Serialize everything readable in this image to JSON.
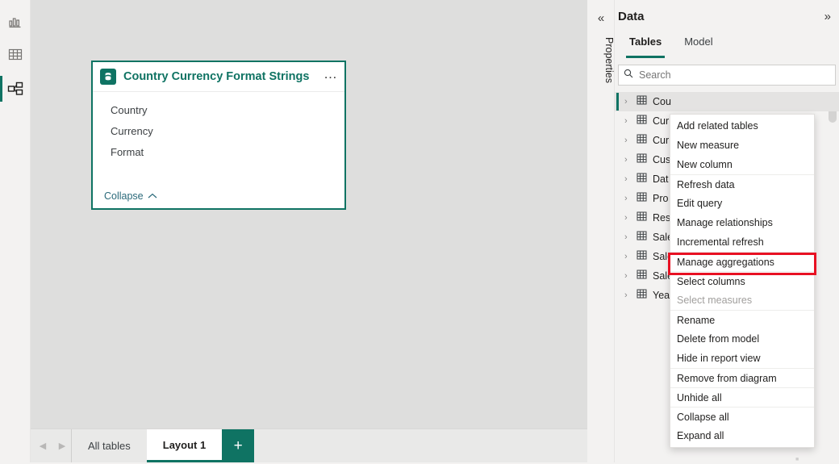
{
  "rail": {
    "items": [
      {
        "name": "report-view",
        "icon": "bar-chart-icon",
        "active": false
      },
      {
        "name": "table-view",
        "icon": "table-grid-icon",
        "active": false
      },
      {
        "name": "model-view",
        "icon": "model-diagram-icon",
        "active": true
      }
    ]
  },
  "canvas": {
    "table_card": {
      "icon": "database-table-icon",
      "title": "Country Currency Format Strings",
      "more_label": "…",
      "fields": [
        "Country",
        "Currency",
        "Format"
      ],
      "collapse_label": "Collapse",
      "border_color": "#0f7363"
    }
  },
  "tabstrip": {
    "prev_arrow": "◀",
    "next_arrow": "▶",
    "tabs": [
      {
        "label": "All tables",
        "active": false
      },
      {
        "label": "Layout 1",
        "active": true
      }
    ],
    "add_label": "+",
    "add_color": "#0f7363"
  },
  "properties_strip": {
    "collapse_icon": "«",
    "label": "Properties"
  },
  "data_pane": {
    "title": "Data",
    "expand_icon": "»",
    "tabs": [
      {
        "label": "Tables",
        "active": true
      },
      {
        "label": "Model",
        "active": false
      }
    ],
    "search": {
      "placeholder": "Search",
      "value": "",
      "icon": "search-icon"
    },
    "tables": [
      {
        "label": "Cou",
        "selected": true
      },
      {
        "label": "Cur",
        "selected": false
      },
      {
        "label": "Cur",
        "selected": false
      },
      {
        "label": "Cus",
        "selected": false
      },
      {
        "label": "Dat",
        "selected": false
      },
      {
        "label": "Pro",
        "selected": false
      },
      {
        "label": "Res",
        "selected": false
      },
      {
        "label": "Sale",
        "selected": false
      },
      {
        "label": "Sale",
        "selected": false
      },
      {
        "label": "Sale",
        "selected": false
      },
      {
        "label": "Year",
        "selected": false
      }
    ]
  },
  "context_menu": {
    "items": [
      {
        "label": "Add related tables",
        "disabled": false,
        "separator": false,
        "highlighted": false
      },
      {
        "label": "New measure",
        "disabled": false,
        "separator": false,
        "highlighted": false
      },
      {
        "label": "New column",
        "disabled": false,
        "separator": false,
        "highlighted": false
      },
      {
        "label": "Refresh data",
        "disabled": false,
        "separator": true,
        "highlighted": false
      },
      {
        "label": "Edit query",
        "disabled": false,
        "separator": false,
        "highlighted": false
      },
      {
        "label": "Manage relationships",
        "disabled": false,
        "separator": false,
        "highlighted": false
      },
      {
        "label": "Incremental refresh",
        "disabled": false,
        "separator": false,
        "highlighted": false
      },
      {
        "label": "Manage aggregations",
        "disabled": false,
        "separator": true,
        "highlighted": true
      },
      {
        "label": "Select columns",
        "disabled": false,
        "separator": true,
        "highlighted": false
      },
      {
        "label": "Select measures",
        "disabled": true,
        "separator": false,
        "highlighted": false
      },
      {
        "label": "Rename",
        "disabled": false,
        "separator": true,
        "highlighted": false
      },
      {
        "label": "Delete from model",
        "disabled": false,
        "separator": false,
        "highlighted": false
      },
      {
        "label": "Hide in report view",
        "disabled": false,
        "separator": false,
        "highlighted": false
      },
      {
        "label": "Remove from diagram",
        "disabled": false,
        "separator": true,
        "highlighted": false
      },
      {
        "label": "Unhide all",
        "disabled": false,
        "separator": true,
        "highlighted": false
      },
      {
        "label": "Collapse all",
        "disabled": false,
        "separator": true,
        "highlighted": false
      },
      {
        "label": "Expand all",
        "disabled": false,
        "separator": false,
        "highlighted": false
      }
    ],
    "highlight_color": "#e81123"
  }
}
